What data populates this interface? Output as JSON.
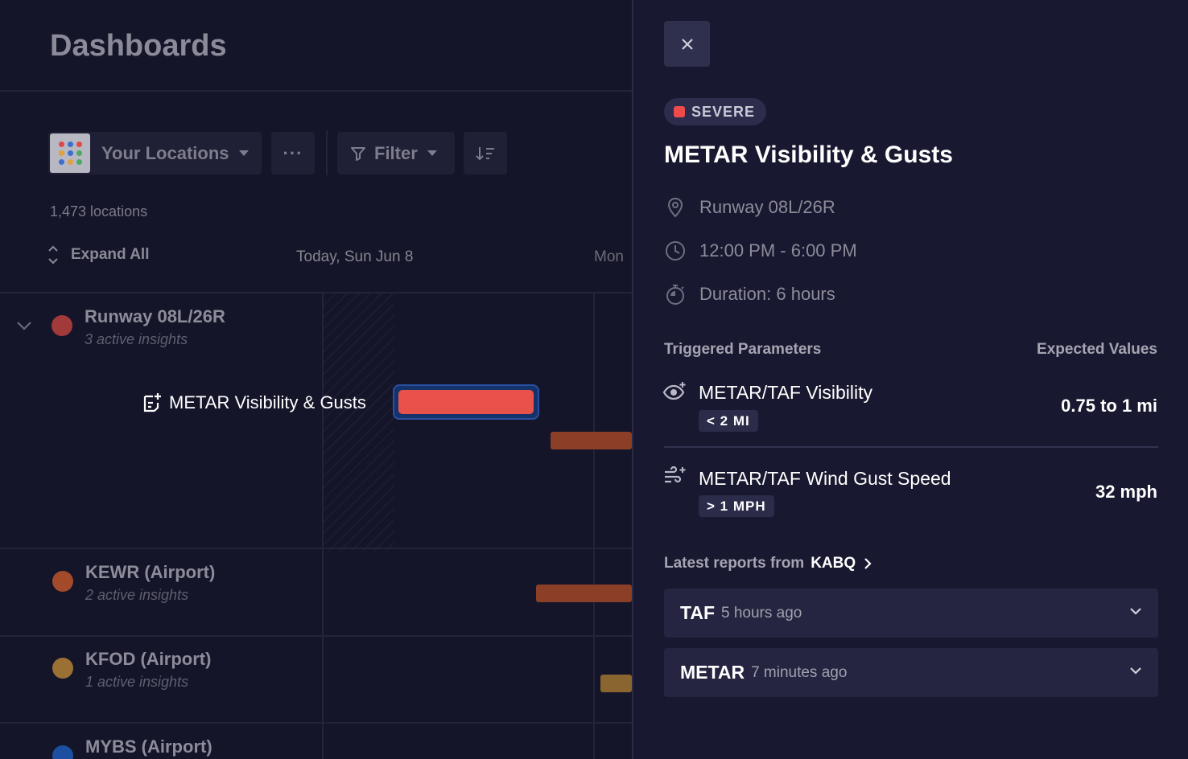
{
  "dashboard": {
    "title": "Dashboards",
    "toolbar": {
      "locations_label": "Your Locations",
      "more_label": "···",
      "filter_label": "Filter"
    },
    "location_count": "1,473 locations",
    "expand_all": "Expand All",
    "timeline": {
      "today": "Today, Sun Jun 8",
      "next": "Mon"
    },
    "locations": [
      {
        "name": "Runway 08L/26R",
        "sub": "3 active insights",
        "color": "#a33a3a"
      },
      {
        "name": "KEWR (Airport)",
        "sub": "2 active insights",
        "color": "#a24a2a"
      },
      {
        "name": "KFOD (Airport)",
        "sub": "1 active insights",
        "color": "#9a7034"
      },
      {
        "name": "MYBS (Airport)",
        "sub": "",
        "color": "#1c4fa0"
      }
    ],
    "insight": {
      "label": "METAR Visibility & Gusts"
    }
  },
  "panel": {
    "severity": "SEVERE",
    "severity_color": "#f04a4a",
    "title": "METAR Visibility & Gusts",
    "location": "Runway 08L/26R",
    "time_range": "12:00 PM - 6:00 PM",
    "duration": "Duration: 6 hours",
    "params_header": "Triggered Parameters",
    "values_header": "Expected Values",
    "params": [
      {
        "name": "METAR/TAF Visibility",
        "threshold": "< 2 MI",
        "value": "0.75 to 1 mi"
      },
      {
        "name": "METAR/TAF Wind Gust Speed",
        "threshold": ">  1 MPH",
        "value": "32 mph"
      }
    ],
    "latest_label": "Latest reports from",
    "latest_station": "KABQ",
    "reports": [
      {
        "type": "TAF",
        "ago": "5 hours ago"
      },
      {
        "type": "METAR",
        "ago": "7 minutes ago"
      }
    ]
  }
}
